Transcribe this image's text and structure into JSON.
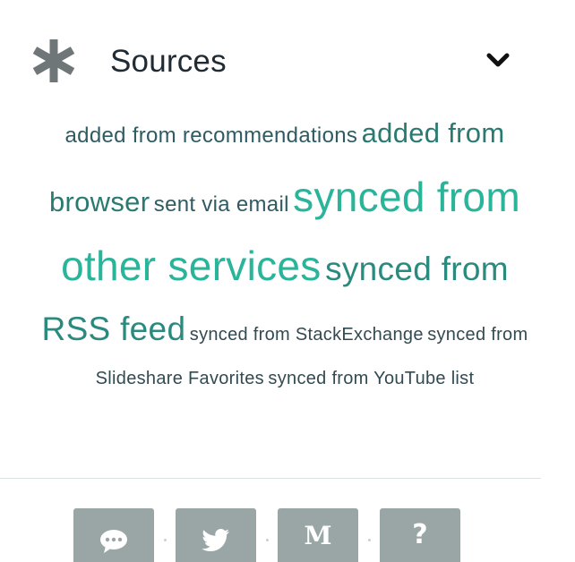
{
  "header": {
    "title": "Sources",
    "icon": "asterisk-icon",
    "toggle_icon": "chevron-down-icon"
  },
  "colors": {
    "text_dark": "#212b33",
    "tag_small": "#2e5c62",
    "tag_medium": "#2a7a72",
    "tag_large": "#2ab49a",
    "icon_gray": "#6f7678",
    "footer_button": "#9aa6a6"
  },
  "tags": [
    {
      "label": "added from recommendations",
      "size": "m",
      "color": "#2e5c62"
    },
    {
      "label": "added from browser",
      "size": "l",
      "color": "#2a7a72"
    },
    {
      "label": "sent via email",
      "size": "m",
      "color": "#2e5c62"
    },
    {
      "label": "synced from other services",
      "size": "xl",
      "color": "#2ab49a"
    },
    {
      "label": "synced from RSS feed",
      "size": "l2",
      "color": "#2a8a7e"
    },
    {
      "label": "synced from StackExchange",
      "size": "s",
      "color": "#324a52"
    },
    {
      "label": "synced from Slideshare Favorites",
      "size": "s",
      "color": "#324a52"
    },
    {
      "label": "synced from YouTube list",
      "size": "s",
      "color": "#324a52"
    }
  ],
  "footer": {
    "buttons": [
      {
        "icon": "chat-bubble-icon",
        "glyph": ""
      },
      {
        "icon": "twitter-bird-icon",
        "glyph": ""
      },
      {
        "icon": "medium-logo-icon",
        "glyph": "M"
      },
      {
        "icon": "question-mark-icon",
        "glyph": "?"
      }
    ]
  }
}
